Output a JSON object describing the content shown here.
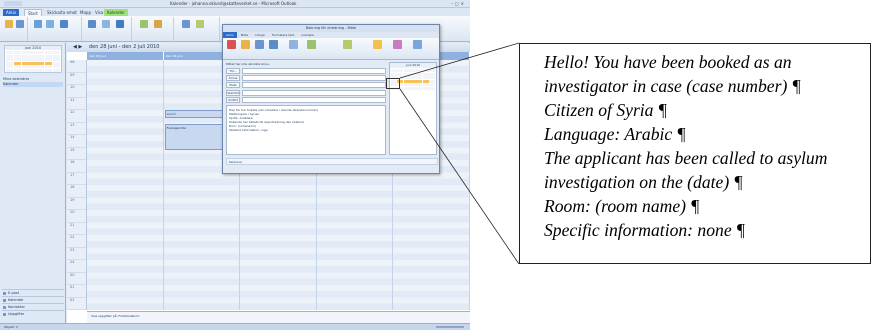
{
  "outlook": {
    "title": "Kalender - johanna.eklund@skatteverket.se - Microsoft Outlook",
    "tabs": [
      "Arkiv",
      "Start",
      "Skicka/ta emot",
      "Mapp",
      "Visa",
      "Kalender"
    ],
    "date_range": "den 28 juni - den 2 juli 2010",
    "days": [
      "den 28 juni",
      "den 29 juni",
      "den 30 juni",
      "den 1 juli",
      "den 2 juli"
    ],
    "hours": [
      "08",
      "09",
      "10",
      "11",
      "12",
      "13",
      "14",
      "15",
      "16",
      "17",
      "18",
      "19",
      "20",
      "21",
      "22",
      "23",
      "24",
      "00",
      "01",
      "02"
    ],
    "appointments": [
      {
        "day": 1,
        "label": "Lunch"
      },
      {
        "day": 2,
        "label": "Lunch"
      },
      {
        "day": 1,
        "label": "Fredagsmöte"
      },
      {
        "day": 2,
        "label": "Bokning för utredning"
      }
    ],
    "minical_month": "juni 2010",
    "my_calendars_label": "Mina kalendrar",
    "calendar_name": "Kalender",
    "nav": [
      "E-post",
      "Kalender",
      "Kontakter",
      "Uppgifter"
    ],
    "tasks_text": "Visa uppgifter på: Förfallodatum",
    "status": "Objekt: 3"
  },
  "meeting": {
    "title": "Bokning för utredning - Möte",
    "info": "Mötet har inte skickats ännu.",
    "to_label": "Till...",
    "subject_label": "Ämne",
    "location_label": "Plats",
    "start_label": "Starttid",
    "end_label": "Sluttid",
    "body_lines": [
      "Hej! Du har bokats som utredare i ärende (ärendenummer)",
      "Medborgare i Syrien",
      "Språk: Arabiska",
      "Sökande har kallats till asylutredning den (datum)",
      "Rum: (rumsnamn)",
      "Särskild information: inga"
    ],
    "people_pane": "Personer"
  },
  "callout": {
    "lines": [
      "Hello! You have been booked as an",
      "investigator in case (case number) ¶",
      "Citizen of Syria ¶",
      "Language: Arabic ¶",
      "The applicant has been called to asylum",
      "investigation on the (date) ¶",
      "Room: (room name) ¶",
      "Specific information: none ¶"
    ]
  }
}
